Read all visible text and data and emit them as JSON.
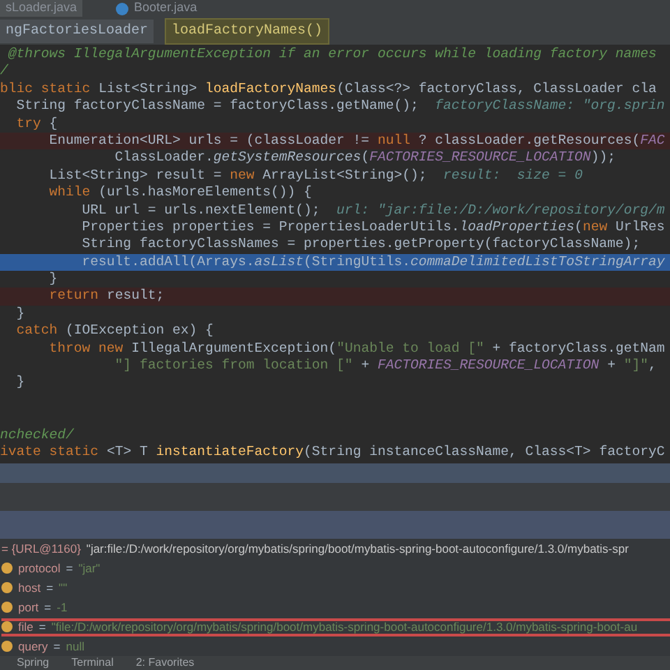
{
  "tabs": [
    {
      "label": "sLoader.java",
      "selected": true
    },
    {
      "label": "Booter.java",
      "selected": false
    }
  ],
  "breadcrumb": [
    {
      "label": "ngFactoriesLoader",
      "selected": false
    },
    {
      "label": "loadFactoryNames()",
      "selected": true
    }
  ],
  "code_lines": [
    {
      "kind": "normal",
      "segments": [
        {
          "kind": "doc",
          "text": " @throws IllegalArgumentException if an error occurs while loading factory names"
        }
      ]
    },
    {
      "kind": "normal",
      "segments": [
        {
          "kind": "doc",
          "text": "/"
        }
      ]
    },
    {
      "kind": "normal",
      "segments": [
        {
          "kind": "kw",
          "text": "blic static "
        },
        {
          "kind": "plain",
          "text": "List<String> "
        },
        {
          "kind": "fn",
          "text": "loadFactoryNames"
        },
        {
          "kind": "plain",
          "text": "(Class<?> factoryClass, ClassLoader cla"
        }
      ]
    },
    {
      "kind": "normal",
      "segments": [
        {
          "kind": "plain",
          "text": "  String factoryClassName = factoryClass.getName();  "
        },
        {
          "kind": "hint",
          "text": "factoryClassName: \"org.sprin"
        }
      ]
    },
    {
      "kind": "normal",
      "segments": [
        {
          "kind": "kw",
          "text": "  try "
        },
        {
          "kind": "plain",
          "text": "{"
        }
      ]
    },
    {
      "kind": "breakpoint",
      "segments": [
        {
          "kind": "plain",
          "text": "      Enumeration<URL> urls = (classLoader != "
        },
        {
          "kind": "kw",
          "text": "null "
        },
        {
          "kind": "plain",
          "text": "? classLoader.getResources("
        },
        {
          "kind": "const",
          "text": "FAC"
        }
      ]
    },
    {
      "kind": "normal",
      "segments": [
        {
          "kind": "plain",
          "text": "              ClassLoader."
        },
        {
          "kind": "italic",
          "text": "getSystemResources"
        },
        {
          "kind": "plain",
          "text": "("
        },
        {
          "kind": "const",
          "text": "FACTORIES_RESOURCE_LOCATION"
        },
        {
          "kind": "plain",
          "text": "));"
        }
      ]
    },
    {
      "kind": "normal",
      "segments": [
        {
          "kind": "plain",
          "text": "      List<String> result = "
        },
        {
          "kind": "kw",
          "text": "new "
        },
        {
          "kind": "plain",
          "text": "ArrayList<String>();  "
        },
        {
          "kind": "hint",
          "text": "result:  size = 0"
        }
      ]
    },
    {
      "kind": "normal",
      "segments": [
        {
          "kind": "kw",
          "text": "      while "
        },
        {
          "kind": "plain",
          "text": "(urls.hasMoreElements()) {"
        }
      ]
    },
    {
      "kind": "normal",
      "segments": [
        {
          "kind": "plain",
          "text": "          URL url = urls.nextElement();  "
        },
        {
          "kind": "hint",
          "text": "url: \"jar:file:/D:/work/repository/org/m"
        }
      ]
    },
    {
      "kind": "normal",
      "segments": [
        {
          "kind": "plain",
          "text": "          Properties properties = PropertiesLoaderUtils."
        },
        {
          "kind": "italic",
          "text": "loadProperties"
        },
        {
          "kind": "plain",
          "text": "("
        },
        {
          "kind": "kw",
          "text": "new "
        },
        {
          "kind": "plain",
          "text": "UrlRes"
        }
      ]
    },
    {
      "kind": "normal",
      "segments": [
        {
          "kind": "plain",
          "text": "          String factoryClassNames = properties.getProperty(factoryClassName);"
        }
      ]
    },
    {
      "kind": "current",
      "segments": [
        {
          "kind": "plain",
          "text": "          result.addAll(Arrays."
        },
        {
          "kind": "italic",
          "text": "asList"
        },
        {
          "kind": "plain",
          "text": "(StringUtils."
        },
        {
          "kind": "italic",
          "text": "commaDelimitedListToStringArray"
        }
      ]
    },
    {
      "kind": "normal",
      "segments": [
        {
          "kind": "plain",
          "text": "      }"
        }
      ]
    },
    {
      "kind": "breakpoint",
      "segments": [
        {
          "kind": "kw",
          "text": "      return "
        },
        {
          "kind": "plain",
          "text": "result;"
        }
      ]
    },
    {
      "kind": "normal",
      "segments": [
        {
          "kind": "plain",
          "text": "  }"
        }
      ]
    },
    {
      "kind": "normal",
      "segments": [
        {
          "kind": "kw",
          "text": "  catch "
        },
        {
          "kind": "plain",
          "text": "(IOException ex) {"
        }
      ]
    },
    {
      "kind": "normal",
      "segments": [
        {
          "kind": "kw",
          "text": "      throw new "
        },
        {
          "kind": "plain",
          "text": "IllegalArgumentException("
        },
        {
          "kind": "str",
          "text": "\"Unable to load [\" "
        },
        {
          "kind": "plain",
          "text": "+ factoryClass.getNam"
        }
      ]
    },
    {
      "kind": "normal",
      "segments": [
        {
          "kind": "str",
          "text": "              \"] factories from location [\" "
        },
        {
          "kind": "plain",
          "text": "+ "
        },
        {
          "kind": "const",
          "text": "FACTORIES_RESOURCE_LOCATION "
        },
        {
          "kind": "plain",
          "text": "+ "
        },
        {
          "kind": "str",
          "text": "\"]\""
        },
        {
          "kind": "plain",
          "text": ","
        }
      ]
    },
    {
      "kind": "normal",
      "segments": [
        {
          "kind": "plain",
          "text": "  }"
        }
      ]
    },
    {
      "kind": "normal"
    },
    {
      "kind": "normal"
    },
    {
      "kind": "normal",
      "segments": [
        {
          "kind": "doc",
          "text": "nchecked/"
        }
      ]
    },
    {
      "kind": "normal",
      "segments": [
        {
          "kind": "kw",
          "text": "ivate static "
        },
        {
          "kind": "plain",
          "text": "<T> T "
        },
        {
          "kind": "fn",
          "text": "instantiateFactory"
        },
        {
          "kind": "plain",
          "text": "(String instanceClassName, Class<T> factoryC"
        }
      ]
    }
  ],
  "variables": [
    {
      "name": "= {URL@1160}",
      "value": "\"jar:file:/D:/work/repository/org/mybatis/spring/boot/mybatis-spring-boot-autoconfigure/1.3.0/mybatis-spr",
      "icon": false,
      "selected": false
    },
    {
      "name": "protocol",
      "sep": "=",
      "value": "\"jar\"",
      "icon": true,
      "selected": false
    },
    {
      "name": "host",
      "sep": "=",
      "value": "\"\"",
      "icon": true,
      "selected": false
    },
    {
      "name": "port",
      "sep": "=",
      "value": "-1",
      "icon": true,
      "selected": false
    },
    {
      "name": "file",
      "sep": "=",
      "value": "\"file:/D:/work/repository/org/mybatis/spring/boot/mybatis-spring-boot-autoconfigure/1.3.0/mybatis-spring-boot-au",
      "icon": true,
      "selected": true
    },
    {
      "name": "query",
      "sep": "=",
      "value": "null",
      "icon": true,
      "selected": false
    }
  ],
  "tool_windows": [
    "Spring",
    "Terminal",
    "2: Favorites"
  ]
}
